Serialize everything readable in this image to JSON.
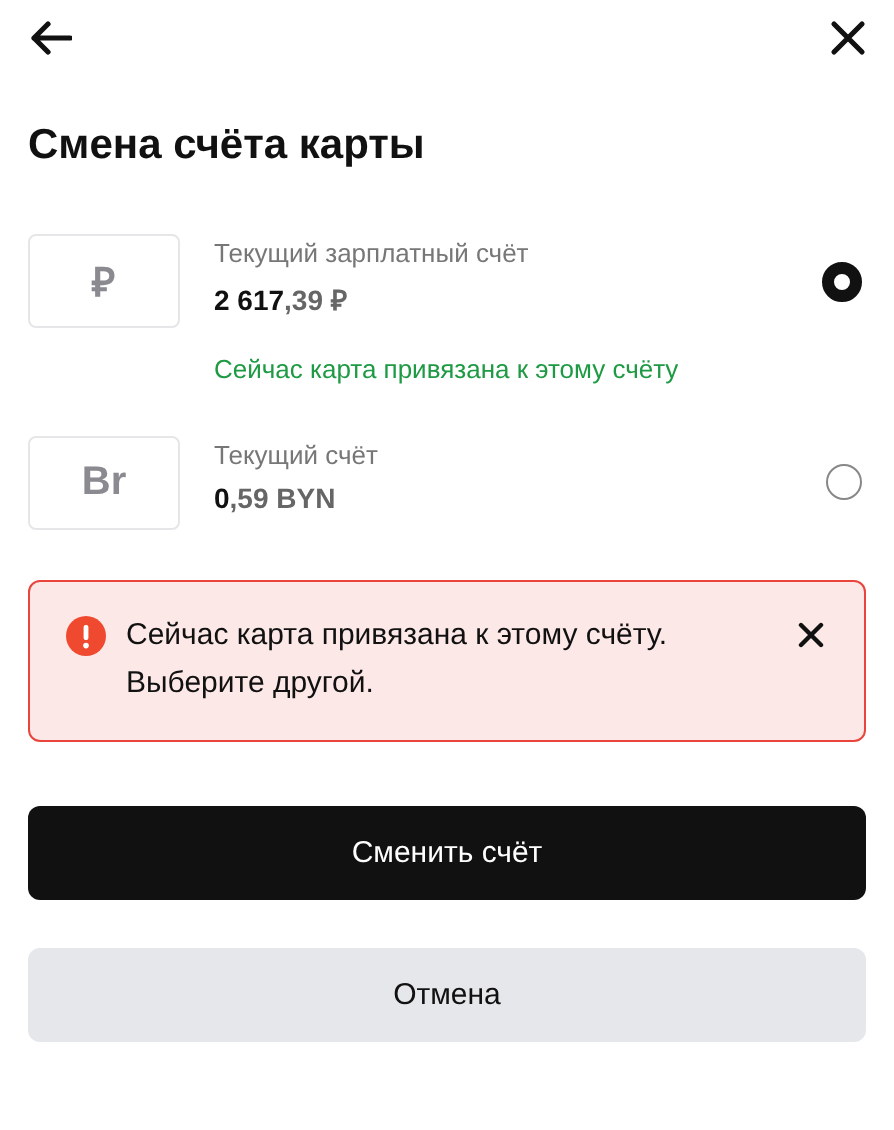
{
  "title": "Смена счёта карты",
  "accounts": [
    {
      "currency_symbol": "₽",
      "name": "Текущий зарплатный счёт",
      "amount_main": "2 617",
      "amount_fraction": ",39 ₽",
      "note": "Сейчас карта привязана к этому счёту",
      "selected": true
    },
    {
      "currency_symbol": "Br",
      "name": "Текущий счёт",
      "amount_main": "0",
      "amount_fraction": ",59 BYN",
      "selected": false
    }
  ],
  "alert": {
    "message": "Сейчас карта привязана к этому счёту. Выберите другой."
  },
  "buttons": [
    {
      "label": "Сменить счёт",
      "kind": "primary"
    },
    {
      "label": "Отмена",
      "kind": "secondary"
    }
  ]
}
